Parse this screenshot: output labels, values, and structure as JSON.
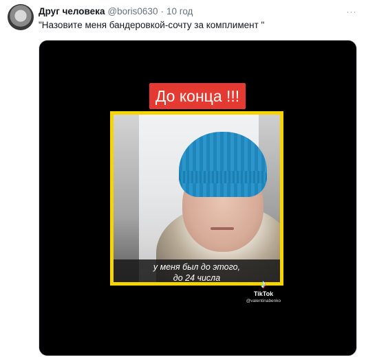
{
  "tweet": {
    "author_name": "Друг человека",
    "handle": "@boris0630",
    "separator": "·",
    "time": "10 год",
    "menu_label": "···",
    "text": "\"Назовите меня бандеровкой-сочту за комплимент \""
  },
  "media": {
    "banner": "До конца !!!",
    "caption_line1": "у меня был до этого,",
    "caption_line2": "до 24 числа",
    "tiktok_glyph": "♪",
    "tiktok_label": "TikTok",
    "tiktok_user": "@valentinabenko"
  },
  "colors": {
    "banner_bg": "#e53a31",
    "frame_border": "#f5d400",
    "media_bg": "#000000"
  }
}
